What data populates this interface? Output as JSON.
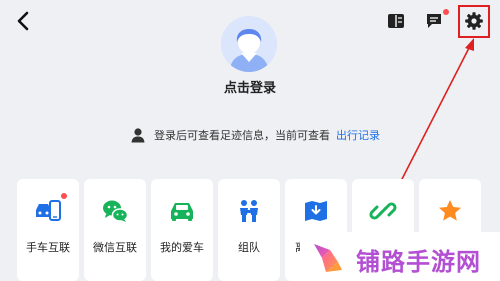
{
  "profile": {
    "login_prompt": "点击登录"
  },
  "info": {
    "message": "登录后可查看足迹信息，当前可查看",
    "link": "出行记录"
  },
  "toolbar": {
    "icons": [
      "back-icon",
      "book-icon",
      "message-icon",
      "settings-icon"
    ]
  },
  "cards": [
    {
      "label": "手车互联",
      "icon": "phone-car-icon",
      "badge": true
    },
    {
      "label": "微信互联",
      "icon": "wechat-icon",
      "badge": false
    },
    {
      "label": "我的爱车",
      "icon": "car-icon",
      "badge": false
    },
    {
      "label": "组队",
      "icon": "team-icon",
      "badge": false
    },
    {
      "label": "离",
      "icon": "offline-map-icon",
      "badge": false
    },
    {
      "label": "",
      "icon": "link-icon",
      "badge": false
    },
    {
      "label": "",
      "icon": "star-icon",
      "badge": false
    }
  ],
  "watermark": {
    "text": "铺路手游网"
  },
  "colors": {
    "accent_blue": "#1f6fe5",
    "green": "#16b35a",
    "badge_red": "#ff4d4f",
    "annotation_red": "#e02020",
    "star_orange": "#ff8a1f",
    "watermark_purple": "#b34fd2"
  }
}
